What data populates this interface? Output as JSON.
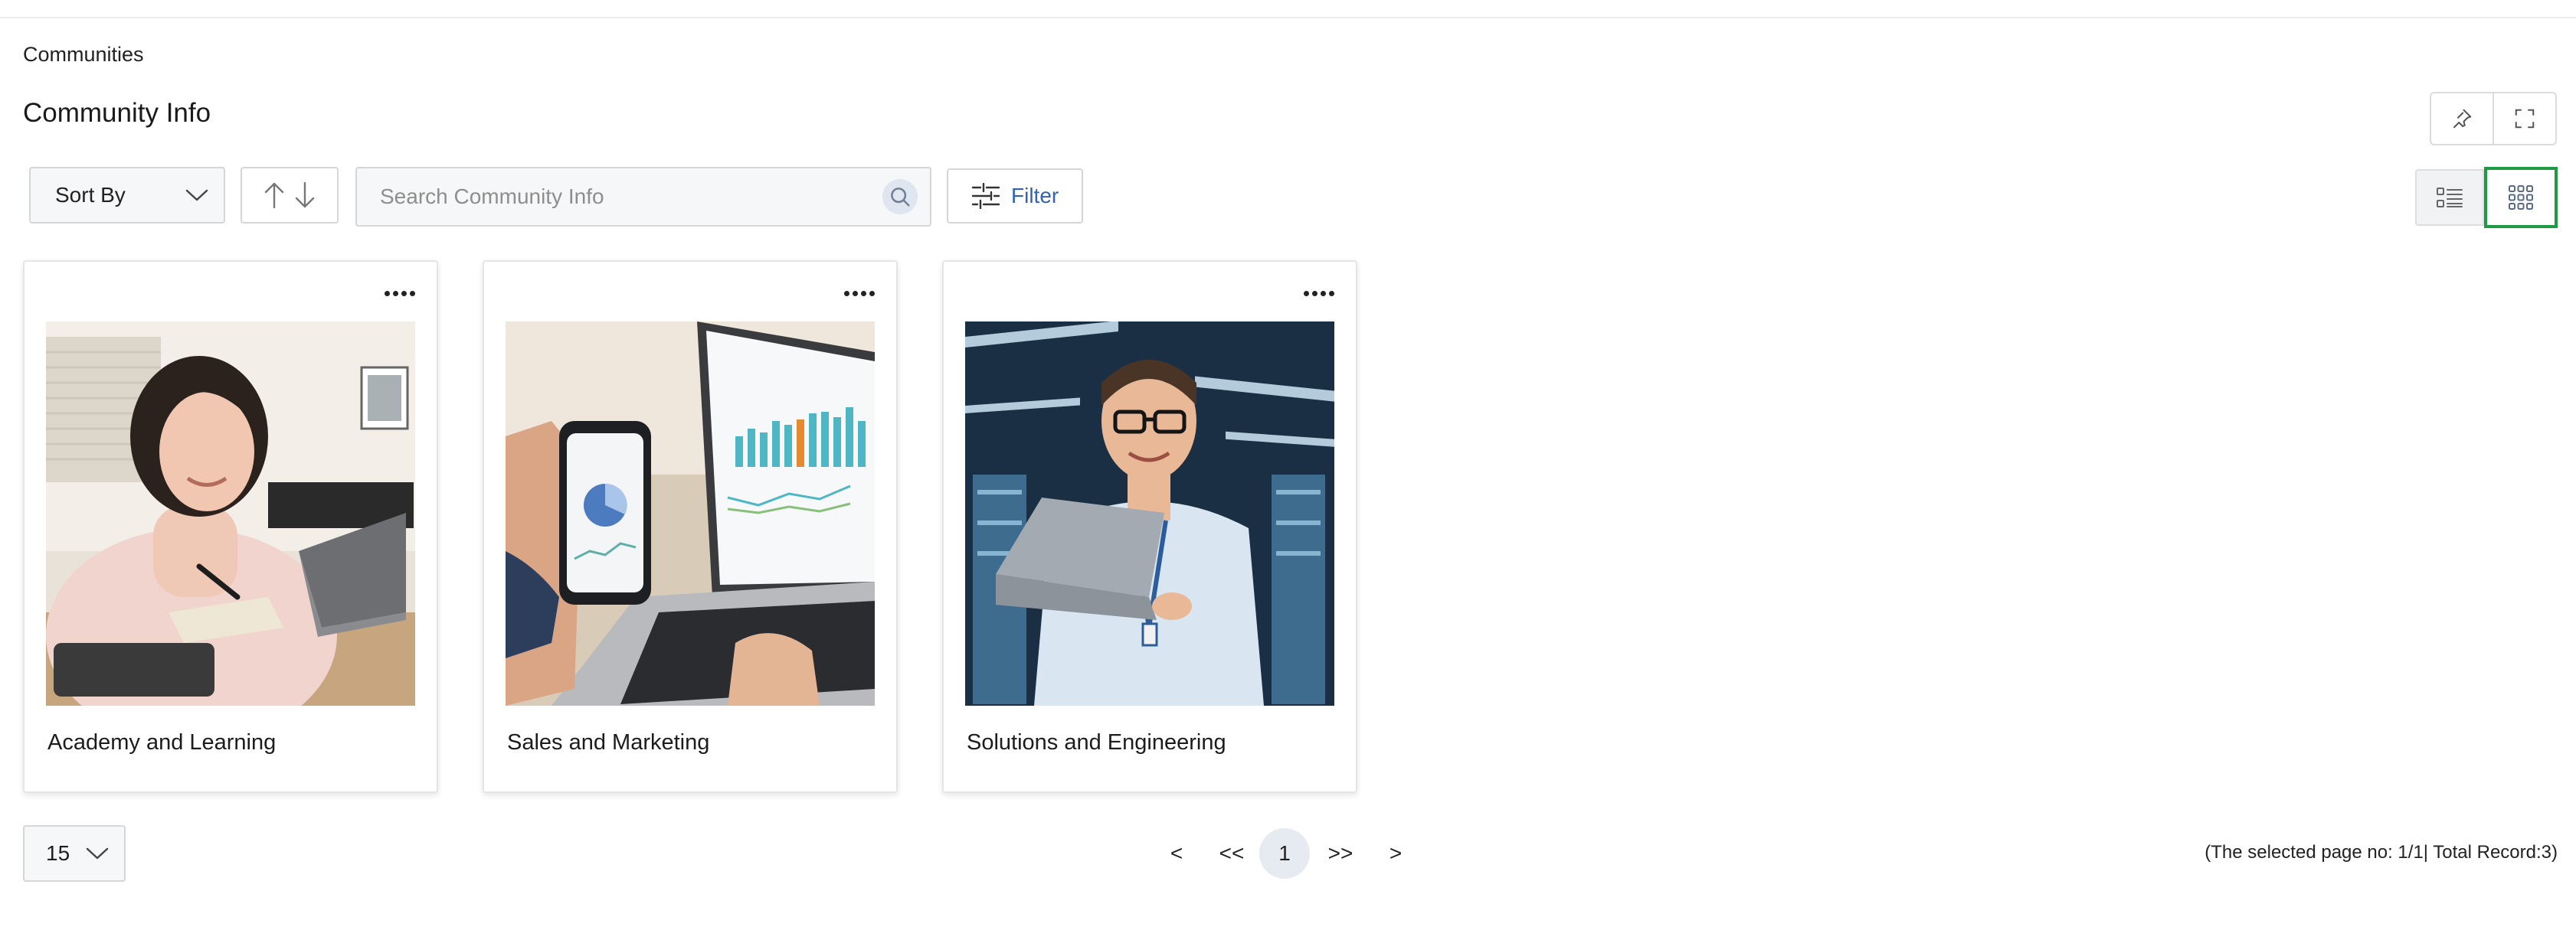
{
  "breadcrumb": "Communities",
  "page_title": "Community Info",
  "toolbar": {
    "sort_label": "Sort By",
    "search_placeholder": "Search Community Info",
    "filter_label": "Filter",
    "active_view": "grid"
  },
  "cards": [
    {
      "title": "Academy and Learning",
      "image": "woman-studying-with-laptop"
    },
    {
      "title": "Sales and Marketing",
      "image": "laptop-and-phone-with-charts"
    },
    {
      "title": "Solutions and Engineering",
      "image": "engineer-holding-laptop-in-data-center"
    }
  ],
  "pagination": {
    "page_size": "15",
    "prev": "<",
    "first": "<<",
    "current": "1",
    "last": ">>",
    "next": ">",
    "record_info": "(The selected page no: 1/1| Total Record:3)"
  },
  "colors": {
    "accent_blue": "#2f62b8",
    "selected_view_border": "#1e9a43"
  },
  "icons": [
    "pin-icon",
    "fullscreen-icon",
    "chevron-down-icon",
    "arrow-up-icon",
    "arrow-down-icon",
    "search-icon",
    "filter-sliders-icon",
    "list-view-icon",
    "grid-view-icon",
    "more-options-icon"
  ]
}
